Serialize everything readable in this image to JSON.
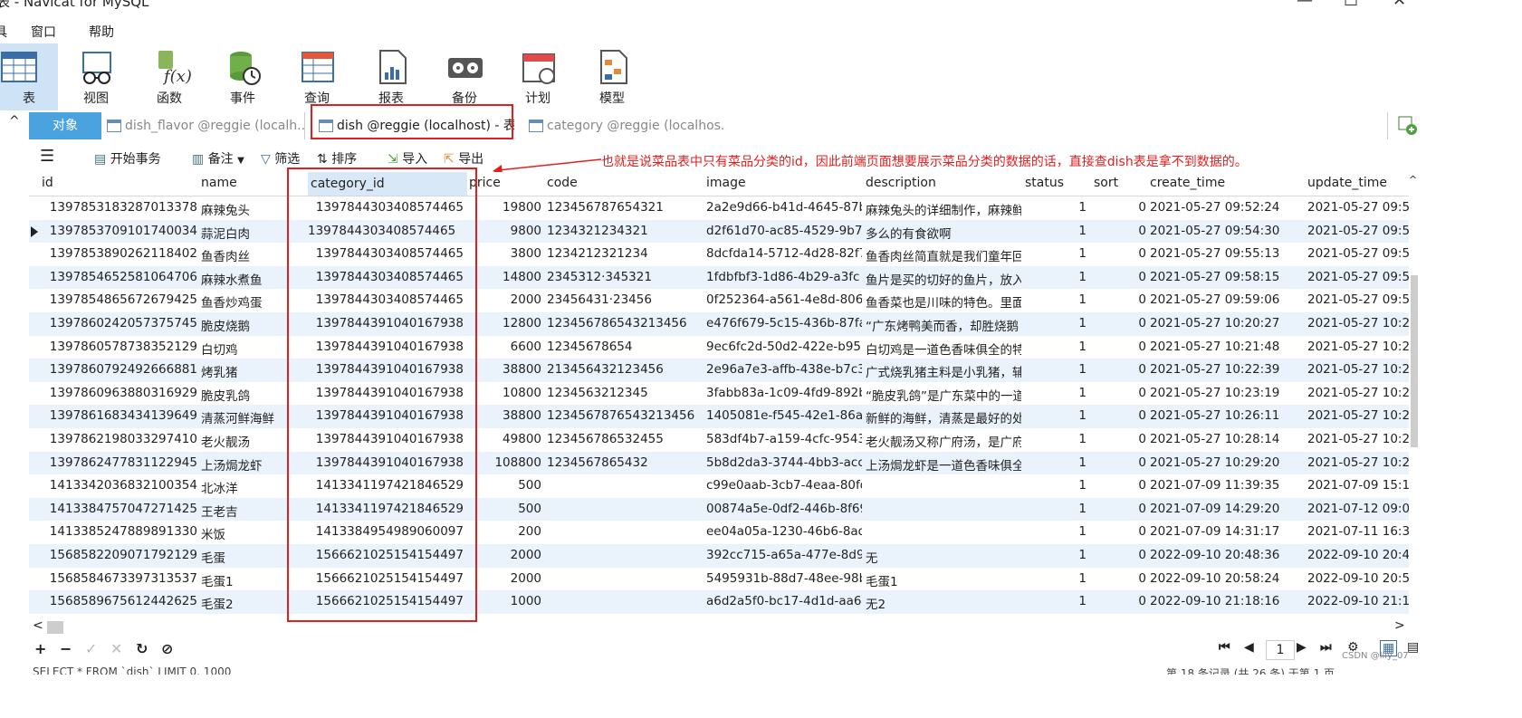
{
  "window": {
    "title": "表 - Navicat for MySQL"
  },
  "menu": [
    "具",
    "窗口",
    "帮助"
  ],
  "ribbon": [
    "表",
    "视图",
    "函数",
    "事件",
    "查询",
    "报表",
    "备份",
    "计划",
    "模型"
  ],
  "tabs": {
    "object": "对象",
    "items": [
      "dish_flavor @reggie (localh...",
      "dish @reggie (localhost) - 表",
      "category @reggie (localhos..."
    ]
  },
  "toolbar": {
    "begin_transaction": "开始事务",
    "memo": "备注",
    "filter": "筛选",
    "sort": "排序",
    "import": "导入",
    "export": "导出"
  },
  "annotation": "也就是说菜品表中只有菜品分类的id，因此前端页面想要展示菜品分类的数据的话，直接查dish表是拿不到数据的。",
  "columns": [
    "id",
    "name",
    "category_id",
    "price",
    "code",
    "image",
    "description",
    "status",
    "sort",
    "create_time",
    "update_time"
  ],
  "rows": [
    [
      "1397853183287013378",
      "麻辣兔头",
      "1397844303408574465",
      "19800",
      "123456787654321",
      "2a2e9d66-b41d-4645-87b",
      "麻辣兔头的详细制作，麻辣鲜",
      "1",
      "0",
      "2021-05-27 09:52:24",
      "2021-05-27 09:5"
    ],
    [
      "1397853709101740034",
      "蒜泥白肉",
      "1397844303408574465",
      "9800",
      "1234321234321",
      "d2f61d70-ac85-4529-9b7",
      "多么的有食欲啊",
      "1",
      "0",
      "2021-05-27 09:54:30",
      "2021-05-27 09:5"
    ],
    [
      "1397853890262118402",
      "鱼香肉丝",
      "1397844303408574465",
      "3800",
      "1234212321234",
      "8dcfda14-5712-4d28-82f7",
      "鱼香肉丝简直就是我们童年回",
      "1",
      "0",
      "2021-05-27 09:55:13",
      "2021-05-27 09:5"
    ],
    [
      "1397854652581064706",
      "麻辣水煮鱼",
      "1397844303408574465",
      "14800",
      "2345312·345321",
      "1fdbfbf3-1d86-4b29-a3fc",
      "鱼片是买的切好的鱼片，放入",
      "1",
      "0",
      "2021-05-27 09:58:15",
      "2021-05-27 09:5"
    ],
    [
      "1397854865672679425",
      "鱼香炒鸡蛋",
      "1397844303408574465",
      "2000",
      "23456431·23456",
      "0f252364-a561-4e8d-806!",
      "鱼香菜也是川味的特色。里面",
      "1",
      "0",
      "2021-05-27 09:59:06",
      "2021-05-27 09:5"
    ],
    [
      "1397860242057375745",
      "脆皮烧鹅",
      "1397844391040167938",
      "12800",
      "123456786543213456",
      "e476f679-5c15-436b-87fa",
      "“广东烤鸭美而香，却胜烧鹅",
      "1",
      "0",
      "2021-05-27 10:20:27",
      "2021-05-27 10:2"
    ],
    [
      "1397860578738352129",
      "白切鸡",
      "1397844391040167938",
      "6600",
      "12345678654",
      "9ec6fc2d-50d2-422e-b95",
      "白切鸡是一道色香味俱全的特",
      "1",
      "0",
      "2021-05-27 10:21:48",
      "2021-05-27 10:2"
    ],
    [
      "1397860792492666881",
      "烤乳猪",
      "1397844391040167938",
      "38800",
      "213456432123456",
      "2e96a7e3-affb-438e-b7c3",
      "广式烧乳猪主料是小乳猪，辅",
      "1",
      "0",
      "2021-05-27 10:22:39",
      "2021-05-27 10:2"
    ],
    [
      "1397860963880316929",
      "脆皮乳鸽",
      "1397844391040167938",
      "10800",
      "1234563212345",
      "3fabb83a-1c09-4fd9-892b",
      "“脆皮乳鸽”是广东菜中的一道",
      "1",
      "0",
      "2021-05-27 10:23:19",
      "2021-05-27 10:2"
    ],
    [
      "1397861683434139649",
      "清蒸河鲜海鲜",
      "1397844391040167938",
      "38800",
      "1234567876543213456",
      "1405081e-f545-42e1-86a",
      "新鲜的海鲜，清蒸是最好的处",
      "1",
      "0",
      "2021-05-27 10:26:11",
      "2021-05-27 10:2"
    ],
    [
      "1397862198033297410",
      "老火靓汤",
      "1397844391040167938",
      "49800",
      "123456786532455",
      "583df4b7-a159-4cfc-9543",
      "老火靓汤又称广府汤，是广府",
      "1",
      "0",
      "2021-05-27 10:28:14",
      "2021-05-27 10:2"
    ],
    [
      "1397862477831122945",
      "上汤焗龙虾",
      "1397844391040167938",
      "108800",
      "1234567865432",
      "5b8d2da3-3744-4bb3-acc",
      "上汤焗龙虾是一道色香味俱全",
      "1",
      "0",
      "2021-05-27 10:29:20",
      "2021-05-27 10:2"
    ],
    [
      "1413342036832100354",
      "北冰洋",
      "1413341197421846529",
      "500",
      "",
      "c99e0aab-3cb7-4eaa-80fd",
      "",
      "1",
      "0",
      "2021-07-09 11:39:35",
      "2021-07-09 15:1"
    ],
    [
      "1413384757047271425",
      "王老吉",
      "1413341197421846529",
      "500",
      "",
      "00874a5e-0df2-446b-8f69",
      "",
      "1",
      "0",
      "2021-07-09 14:29:20",
      "2021-07-12 09:0"
    ],
    [
      "1413385247889891330",
      "米饭",
      "1413384954989060097",
      "200",
      "",
      "ee04a05a-1230-46b6-8ad",
      "",
      "1",
      "0",
      "2021-07-09 14:31:17",
      "2021-07-11 16:3"
    ],
    [
      "1568582209071792129",
      "毛蛋",
      "1566621025154154497",
      "2000",
      "",
      "392cc715-a65a-477e-8d9",
      "无",
      "1",
      "0",
      "2022-09-10 20:48:36",
      "2022-09-10 20:4"
    ],
    [
      "1568584673397313537",
      "毛蛋1",
      "1566621025154154497",
      "2000",
      "",
      "5495931b-88d7-48ee-98b",
      "毛蛋1",
      "1",
      "0",
      "2022-09-10 20:58:24",
      "2022-09-10 20:5"
    ],
    [
      "1568589675612442625",
      "毛蛋2",
      "1566621025154154497",
      "1000",
      "",
      "a6d2a5f0-bc17-4d1d-aa6",
      "无2",
      "1",
      "0",
      "2022-09-10 21:18:16",
      "2022-09-10 21:1"
    ]
  ],
  "pagination": {
    "page": "1"
  },
  "watermark": "CSDN @lily_07",
  "status": {
    "sql": "SELECT * FROM `dish` LIMIT 0, 1000",
    "records": "第 18 条记录 (共 26 条) 于第 1 页"
  }
}
